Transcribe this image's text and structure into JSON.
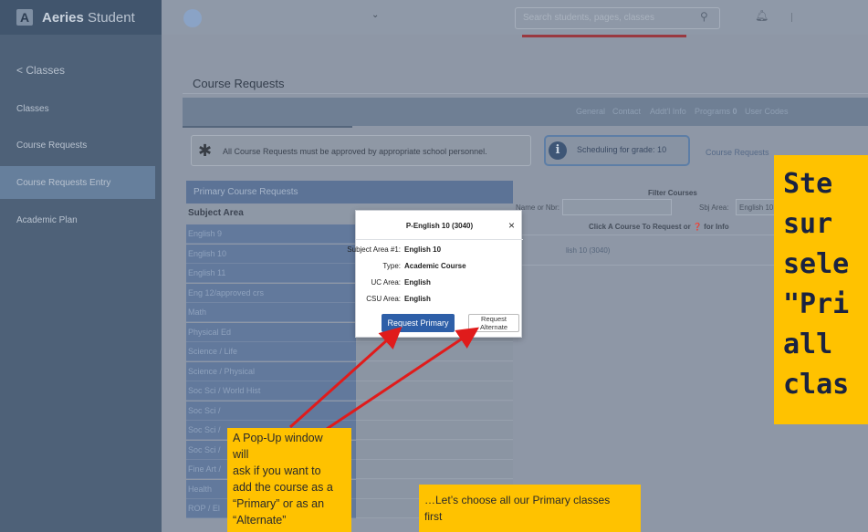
{
  "app": {
    "logo_letter": "A",
    "brand_bold": "Aeries",
    "brand_rest": " Student"
  },
  "sidebar": {
    "back_label": "< Classes",
    "items": [
      {
        "label": "Classes"
      },
      {
        "label": "Course Requests"
      },
      {
        "label": "Course Requests Entry",
        "active": true
      },
      {
        "label": "Academic Plan"
      }
    ]
  },
  "topbar": {
    "search_placeholder": "Search students, pages, classes"
  },
  "page": {
    "title": "Course Requests"
  },
  "tabs": [
    {
      "label": "General"
    },
    {
      "label": "Contact"
    },
    {
      "label": "Addt'l Info"
    },
    {
      "label": "Programs",
      "badge": "0"
    },
    {
      "label": "User Codes"
    }
  ],
  "notice": {
    "text": "All Course Requests must be approved by appropriate school personnel."
  },
  "scheduling": {
    "text": "Scheduling for grade: 10",
    "link": "Course Requests"
  },
  "primary_panel": {
    "header": "Primary Course Requests",
    "subject_header": "Subject Area",
    "subjects": [
      "English 9",
      "English 10",
      "English 11",
      "Eng 12/approved crs",
      "Math",
      "Physical Ed",
      "Science / Life",
      "Science / Physical",
      "Soc Sci / World Hist",
      "Soc Sci /",
      "Soc Sci /",
      "Soc Sci /",
      "Fine Art /",
      "Health",
      "ROP / El"
    ]
  },
  "filter": {
    "title": "Filter Courses",
    "name_label": "Name or Nbr:",
    "sbj_label": "Sbj Area:",
    "sbj_value": "English 10",
    "click_info": "Click A Course To Request or ❓ for Info",
    "course_link": "lish 10 (3040)"
  },
  "popup": {
    "title": "P-English 10 (3040)",
    "close": "×",
    "rows": [
      {
        "label": "Subject Area #1:",
        "value": "English 10"
      },
      {
        "label": "Type:",
        "value": "Academic Course"
      },
      {
        "label": "UC Area:",
        "value": "English"
      },
      {
        "label": "CSU Area:",
        "value": "English"
      }
    ],
    "primary_button": "Request Primary",
    "alternate_button": "Request Alternate"
  },
  "annotations": {
    "step_lines": [
      "Ste",
      "sur",
      "sele",
      "\"Pri",
      "all",
      "clas"
    ],
    "note1_lines": [
      "A Pop-Up window",
      "will",
      "ask if you want to",
      "add the course as a",
      "“Primary” or as an",
      "“Alternate”"
    ],
    "note2_lines": [
      "…Let’s choose all our Primary classes",
      "first"
    ]
  },
  "colors": {
    "arrow": "#e01b1b",
    "highlight": "#ffc200",
    "primary_button": "#2e5fa8"
  }
}
